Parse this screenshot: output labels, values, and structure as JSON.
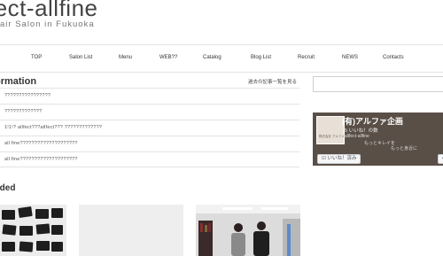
{
  "header": {
    "title": "fect-allfine",
    "subtitle": "air Salon in Fukuoka"
  },
  "nav": {
    "items": [
      {
        "label": "TOP"
      },
      {
        "label": "Salon List"
      },
      {
        "label": "Menu"
      },
      {
        "label": "WEB??"
      },
      {
        "label": "Catalog"
      },
      {
        "label": "Blog List"
      },
      {
        "label": "Recruit"
      },
      {
        "label": "NEWS"
      },
      {
        "label": "Contacts"
      }
    ]
  },
  "information": {
    "title": "ormation",
    "more_link": "過去の記事一覧を見る",
    "items": [
      "????????????????",
      "?????????????",
      "1!1!? allfect???allfect??? ?????????????",
      "all fine????????????????????",
      "all fine????????????????????"
    ]
  },
  "recommended": {
    "title": "ended"
  },
  "facebook": {
    "name": "(有)アルファ企画",
    "likes": "75 いいね！の数",
    "tagline1": "allfect-allfine",
    "tagline2": "もっとキレイを",
    "tagline3": "もっと身近に",
    "like_button": "いいね！済み",
    "share_button": "シ",
    "avatar_text": "株式会社 アルファ企画"
  },
  "colors": {
    "fb_background": "#5a4f47",
    "divider": "#e3e3e3"
  }
}
